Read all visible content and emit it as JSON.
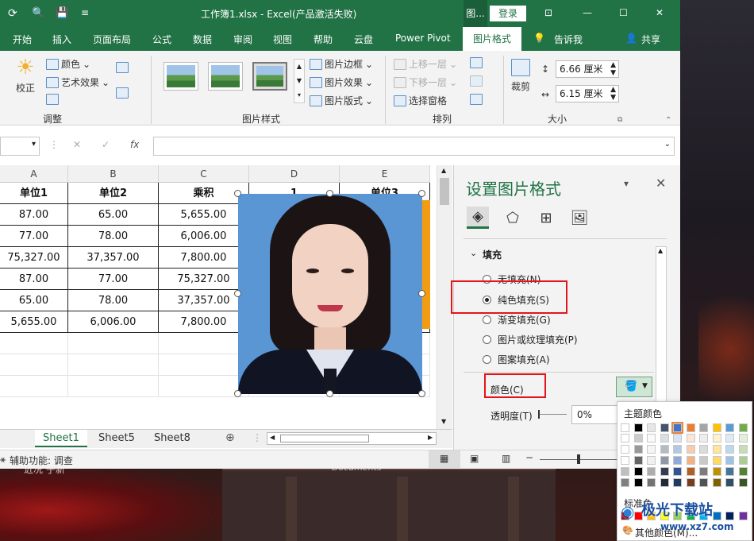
{
  "window": {
    "title": "工作簿1.xlsx  -  Excel(产品激活失败)",
    "title_btn": "图...",
    "login": "登录",
    "ctrl_min": "—",
    "ctrl_max": "☐",
    "ctrl_close": "✕",
    "ctrl_ribbon": "⊡"
  },
  "ribbon_tabs": [
    "开始",
    "插入",
    "页面布局",
    "公式",
    "数据",
    "审阅",
    "视图",
    "帮助",
    "云盘",
    "Power Pivot"
  ],
  "active_tab": "图片格式",
  "tell_me": "告诉我",
  "share": "共享",
  "ribbon": {
    "adjust": {
      "correct": "校正",
      "color": "颜色",
      "artistic": "艺术效果",
      "label": "调整"
    },
    "styles": {
      "border": "图片边框",
      "effects": "图片效果",
      "layout": "图片版式",
      "label": "图片样式"
    },
    "arrange": {
      "forward": "上移一层",
      "backward": "下移一层",
      "pane": "选择窗格",
      "label": "排列"
    },
    "size": {
      "crop": "裁剪",
      "height": "6.66 厘米",
      "width": "6.15 厘米",
      "label": "大小"
    }
  },
  "formula_bar": {
    "fx": "fx",
    "cancel": "✕",
    "confirm": "✓"
  },
  "grid": {
    "columns": [
      "A",
      "B",
      "C",
      "D",
      "E"
    ],
    "header_row": [
      "单位1",
      "单位2",
      "乘积",
      "1",
      "单位3"
    ],
    "rows": [
      [
        "87.00",
        "65.00",
        "5,655.00",
        "",
        ""
      ],
      [
        "77.00",
        "78.00",
        "6,006.00",
        "",
        ""
      ],
      [
        "75,327.00",
        "37,357.00",
        "7,800.00",
        "",
        ""
      ],
      [
        "87.00",
        "77.00",
        "75,327.00",
        "",
        ""
      ],
      [
        "65.00",
        "78.00",
        "37,357.00",
        "",
        ""
      ],
      [
        "5,655.00",
        "6,006.00",
        "7,800.00",
        "",
        ""
      ]
    ]
  },
  "sheets": [
    "Sheet1",
    "Sheet5",
    "Sheet8"
  ],
  "active_sheet": "Sheet1",
  "status": {
    "accessibility": "辅助功能: 调查"
  },
  "pane": {
    "title": "设置图片格式",
    "section": "填充",
    "options": [
      {
        "label": "无填充(N)",
        "checked": false
      },
      {
        "label": "纯色填充(S)",
        "checked": true
      },
      {
        "label": "渐变填充(G)",
        "checked": false
      },
      {
        "label": "图片或纹理填充(P)",
        "checked": false
      },
      {
        "label": "图案填充(A)",
        "checked": false
      }
    ],
    "color_label": "颜色(C)",
    "transparency_label": "透明度(T)",
    "transparency_value": "0%"
  },
  "palette": {
    "theme_label": "主题颜色",
    "standard_label": "标准色",
    "more_label": "其他颜色(M)...",
    "theme_colors": [
      "#ffffff",
      "#000000",
      "#e7e6e6",
      "#44546a",
      "#4472c4",
      "#ed7d31",
      "#a5a5a5",
      "#ffc000",
      "#5b9bd5",
      "#70ad47"
    ],
    "standard_colors": [
      "#c00000",
      "#ff0000",
      "#ffc000",
      "#ffff00",
      "#92d050",
      "#00b050",
      "#00b0f0",
      "#0070c0",
      "#002060",
      "#7030a0"
    ]
  },
  "desktop": {
    "text_left": "近况 子新",
    "text_docs": "Documents"
  },
  "watermark": {
    "brand": "极光下载站",
    "url": "www.xz7.com"
  }
}
